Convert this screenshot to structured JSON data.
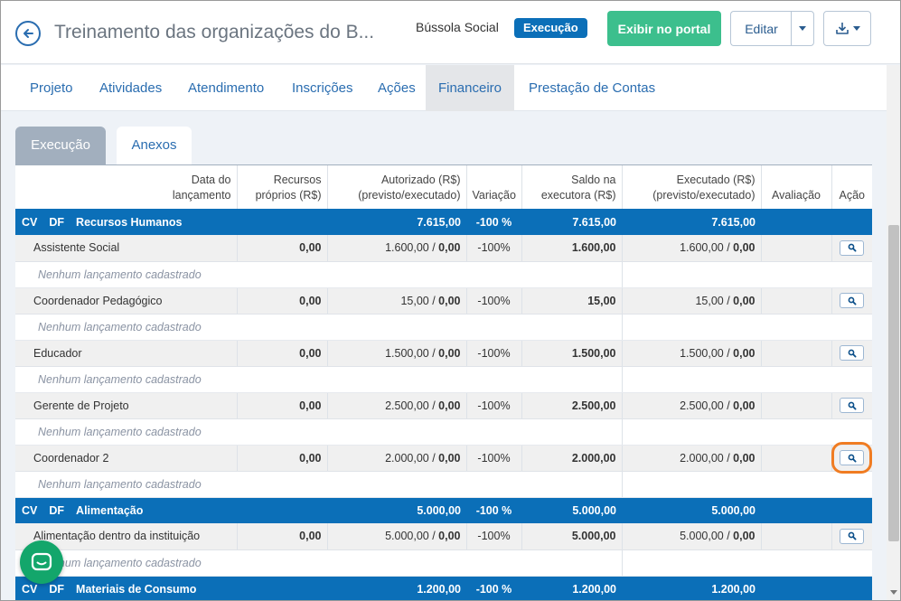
{
  "header": {
    "title": "Treinamento das organizações do B...",
    "product": "Bússola Social",
    "status": "Execução",
    "portal_button": "Exibir no portal",
    "edit_button": "Editar"
  },
  "nav": {
    "tabs": [
      "Projeto",
      "Atividades",
      "Atendimento",
      "Inscrições",
      "Ações",
      "Financeiro",
      "Prestação de Contas"
    ],
    "active": "Financeiro"
  },
  "subtabs": [
    "Execução",
    "Anexos"
  ],
  "table": {
    "headers": {
      "date_l1": "Data do",
      "date_l2": "lançamento",
      "own_l1": "Recursos",
      "own_l2": "próprios (R$)",
      "auth_l1": "Autorizado (R$)",
      "auth_l2": "(previsto/executado)",
      "variation": "Variação",
      "balance_l1": "Saldo na",
      "balance_l2": "executora (R$)",
      "exec_l1": "Executado (R$)",
      "exec_l2": "(previsto/executado)",
      "evaluation": "Avaliação",
      "action": "Ação"
    },
    "cv": "CV",
    "df": "DF",
    "empty_text": "Nenhum lançamento cadastrado",
    "groups": [
      {
        "name": "Recursos Humanos",
        "authorized": "7.615,00",
        "variation": "-100 %",
        "balance": "7.615,00",
        "executed": "7.615,00",
        "items": [
          {
            "name": "Assistente Social",
            "own": "0,00",
            "auth_planned": "1.600,00",
            "auth_exec": "0,00",
            "variation": "-100%",
            "balance": "1.600,00",
            "exec_planned": "1.600,00",
            "exec_exec": "0,00"
          },
          {
            "name": "Coordenador Pedagógico",
            "own": "0,00",
            "auth_planned": "15,00",
            "auth_exec": "0,00",
            "variation": "-100%",
            "balance": "15,00",
            "exec_planned": "15,00",
            "exec_exec": "0,00"
          },
          {
            "name": "Educador",
            "own": "0,00",
            "auth_planned": "1.500,00",
            "auth_exec": "0,00",
            "variation": "-100%",
            "balance": "1.500,00",
            "exec_planned": "1.500,00",
            "exec_exec": "0,00"
          },
          {
            "name": "Gerente de Projeto",
            "own": "0,00",
            "auth_planned": "2.500,00",
            "auth_exec": "0,00",
            "variation": "-100%",
            "balance": "2.500,00",
            "exec_planned": "2.500,00",
            "exec_exec": "0,00"
          },
          {
            "name": "Coordenador 2",
            "own": "0,00",
            "auth_planned": "2.000,00",
            "auth_exec": "0,00",
            "variation": "-100%",
            "balance": "2.000,00",
            "exec_planned": "2.000,00",
            "exec_exec": "0,00"
          }
        ]
      },
      {
        "name": "Alimentação",
        "authorized": "5.000,00",
        "variation": "-100 %",
        "balance": "5.000,00",
        "executed": "5.000,00",
        "items": [
          {
            "name": "Alimentação dentro da instituição",
            "own": "0,00",
            "auth_planned": "5.000,00",
            "auth_exec": "0,00",
            "variation": "-100%",
            "balance": "5.000,00",
            "exec_planned": "5.000,00",
            "exec_exec": "0,00"
          }
        ]
      },
      {
        "name": "Materiais de Consumo",
        "authorized": "1.200,00",
        "variation": "-100 %",
        "balance": "1.200,00",
        "executed": "1.200,00",
        "items": []
      }
    ]
  },
  "colors": {
    "primary": "#0b6fb8",
    "success": "#3cbf8d",
    "highlight": "#f07c22",
    "chat": "#13a66b"
  },
  "icons": [
    "back-arrow-icon",
    "caret-down-icon",
    "download-icon",
    "search-icon",
    "chat-icon"
  ]
}
